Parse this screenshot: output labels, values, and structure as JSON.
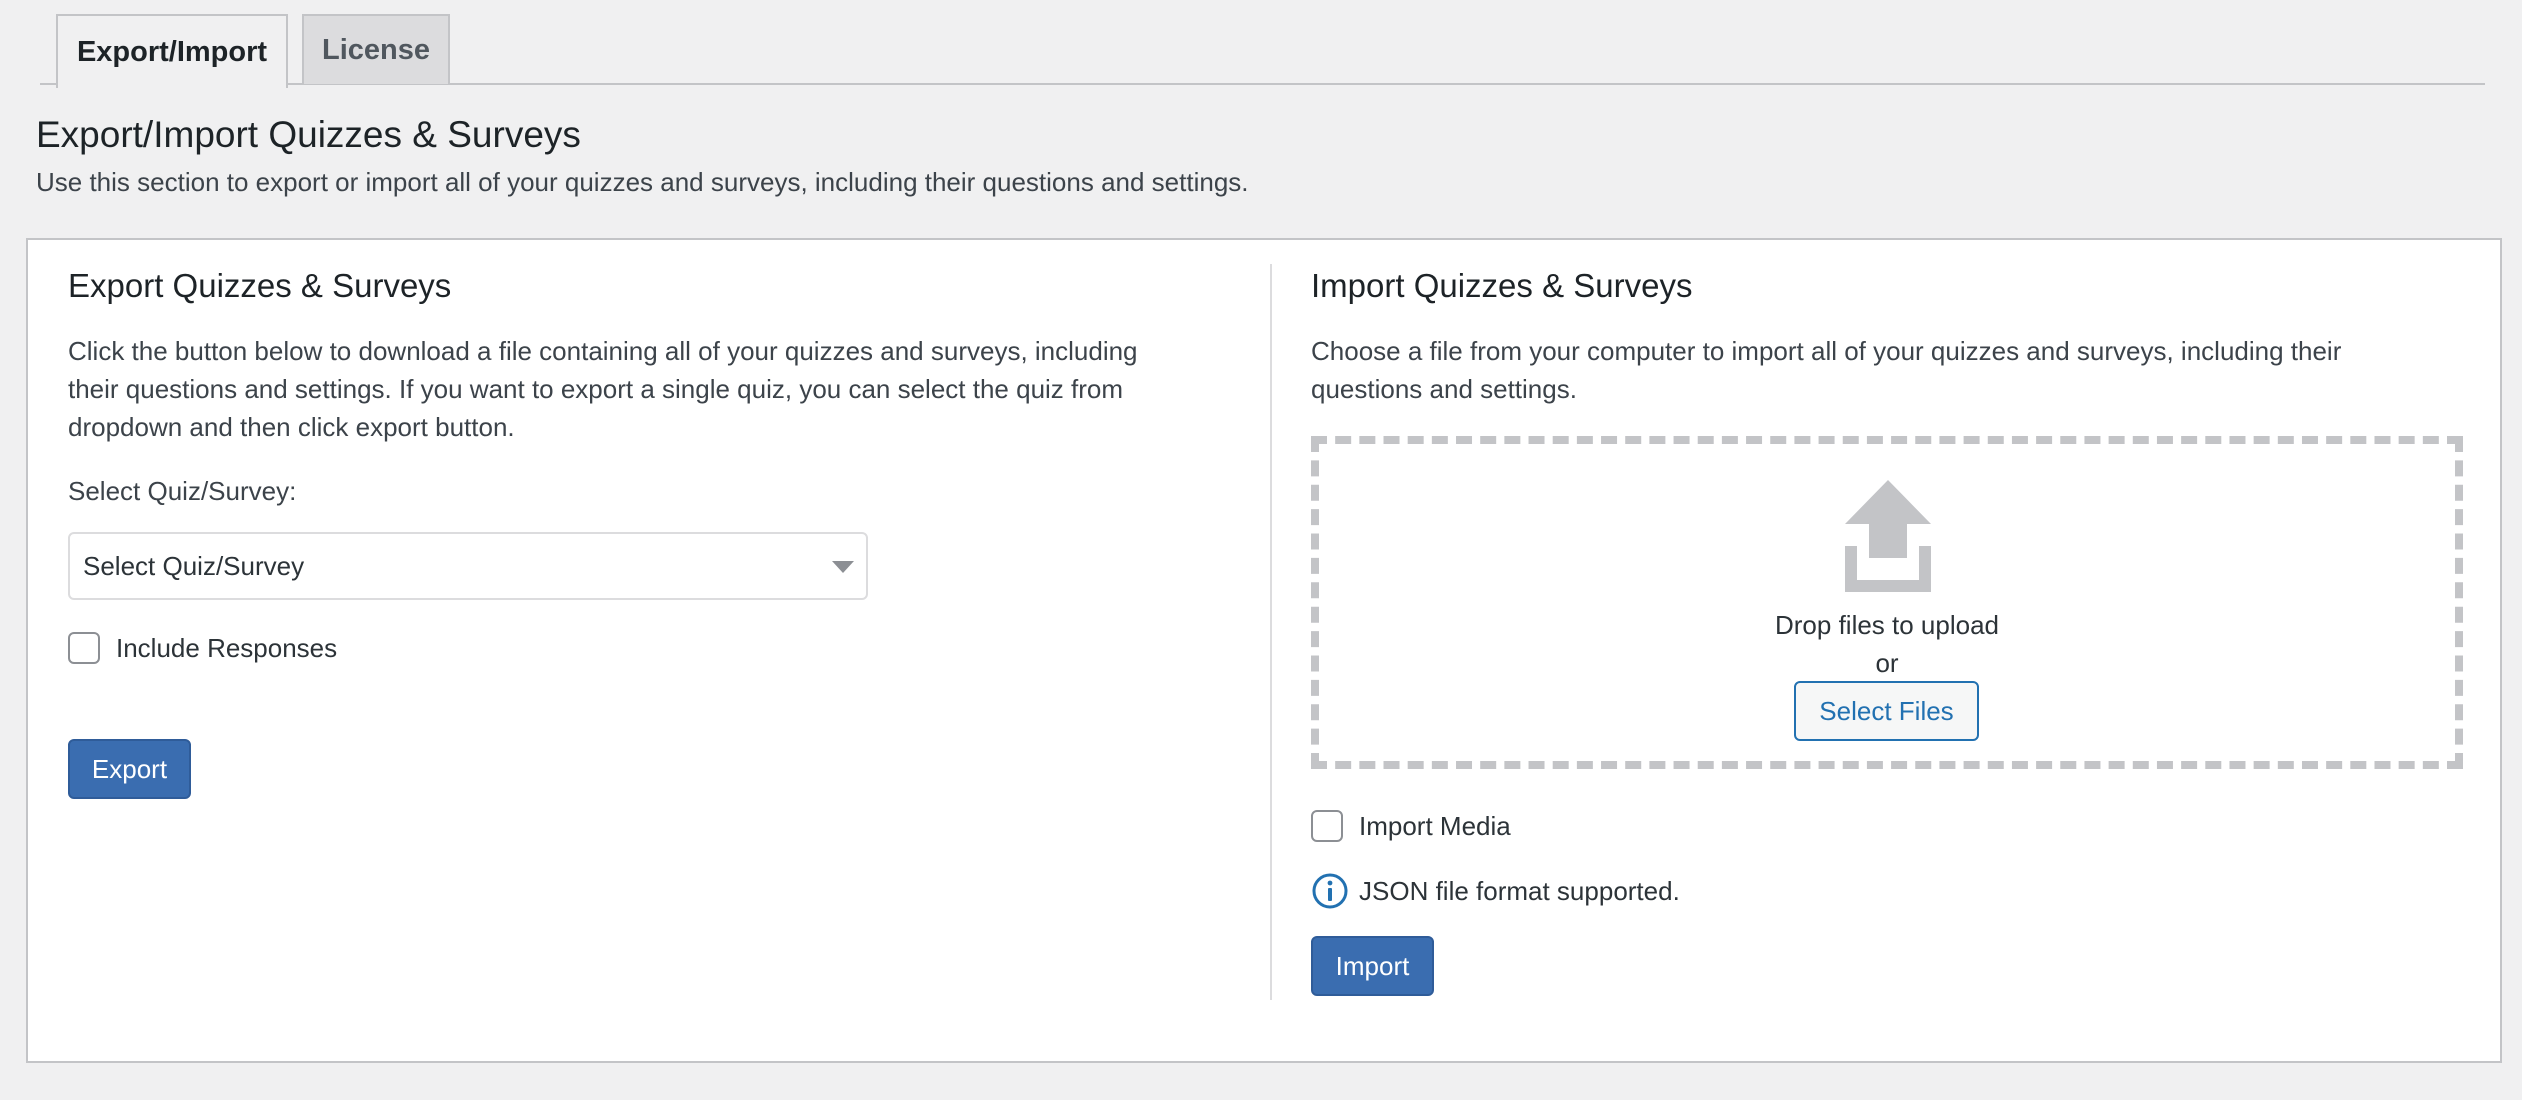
{
  "tabs": [
    {
      "label": "Export/Import",
      "active": true
    },
    {
      "label": "License",
      "active": false
    }
  ],
  "header": {
    "title": "Export/Import Quizzes & Surveys",
    "description": "Use this section to export or import all of your quizzes and surveys, including their questions and settings."
  },
  "export": {
    "title": "Export Quizzes & Surveys",
    "text_lines": [
      "Click the button below to download a file containing all of your quizzes and surveys, including",
      "their questions and settings. If you want to export a single quiz, you can select the quiz from",
      "dropdown and then click export button."
    ],
    "select_label": "Select Quiz/Survey:",
    "select_value": "Select Quiz/Survey",
    "include_responses_label": "Include Responses",
    "export_button": "Export"
  },
  "import": {
    "title": "Import Quizzes & Surveys",
    "text_lines": [
      "Choose a file from your computer to import all of your quizzes and surveys, including their",
      "questions and settings."
    ],
    "drop_text": "Drop files to upload",
    "or_text": "or",
    "select_files_button": "Select Files",
    "import_media_label": "Import Media",
    "format_note": "JSON file format supported.",
    "import_button": "Import"
  },
  "colors": {
    "primary": "#3a6db0",
    "link": "#2271b1",
    "icon_gray": "#c3c4c7",
    "info_blue": "#2271b1"
  },
  "icons": {
    "upload": "upload-arrow-icon",
    "info": "info-circle-icon",
    "dropdown": "caret-down-icon"
  }
}
